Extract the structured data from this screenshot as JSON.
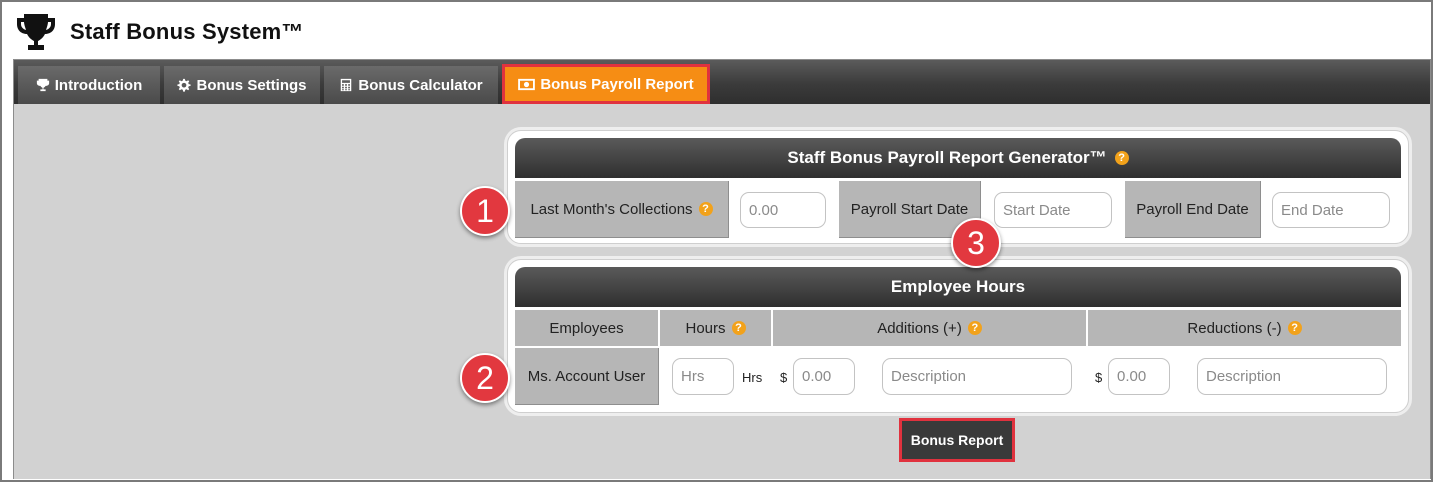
{
  "app": {
    "title": "Staff Bonus System™"
  },
  "tabs": [
    {
      "label": "Introduction",
      "icon": "trophy-icon"
    },
    {
      "label": "Bonus Settings",
      "icon": "gear-icon"
    },
    {
      "label": "Bonus Calculator",
      "icon": "calculator-icon"
    },
    {
      "label": "Bonus Payroll Report",
      "icon": "money-icon",
      "active": true
    }
  ],
  "report_panel": {
    "title": "Staff Bonus Payroll Report Generator™",
    "collections_label": "Last Month's Collections",
    "collections_placeholder": "0.00",
    "start_label": "Payroll Start Date",
    "start_placeholder": "Start Date",
    "end_label": "Payroll End Date",
    "end_placeholder": "End Date"
  },
  "hours_panel": {
    "title": "Employee Hours",
    "columns": {
      "employees": "Employees",
      "hours": "Hours",
      "additions": "Additions (+)",
      "reductions": "Reductions (-)"
    },
    "row": {
      "name": "Ms. Account User",
      "hours_placeholder": "Hrs",
      "hours_unit": "Hrs",
      "currency": "$",
      "addition_placeholder": "0.00",
      "addition_desc_placeholder": "Description",
      "reduction_placeholder": "0.00",
      "reduction_desc_placeholder": "Description"
    }
  },
  "buttons": {
    "bonus_report": "Bonus Report"
  },
  "help_glyph": "?",
  "markers": [
    "1",
    "2",
    "3"
  ],
  "colors": {
    "active_tab": "#f68d14",
    "highlight": "#e0323e",
    "help": "#f2a21b",
    "marker": "#e2383f"
  }
}
